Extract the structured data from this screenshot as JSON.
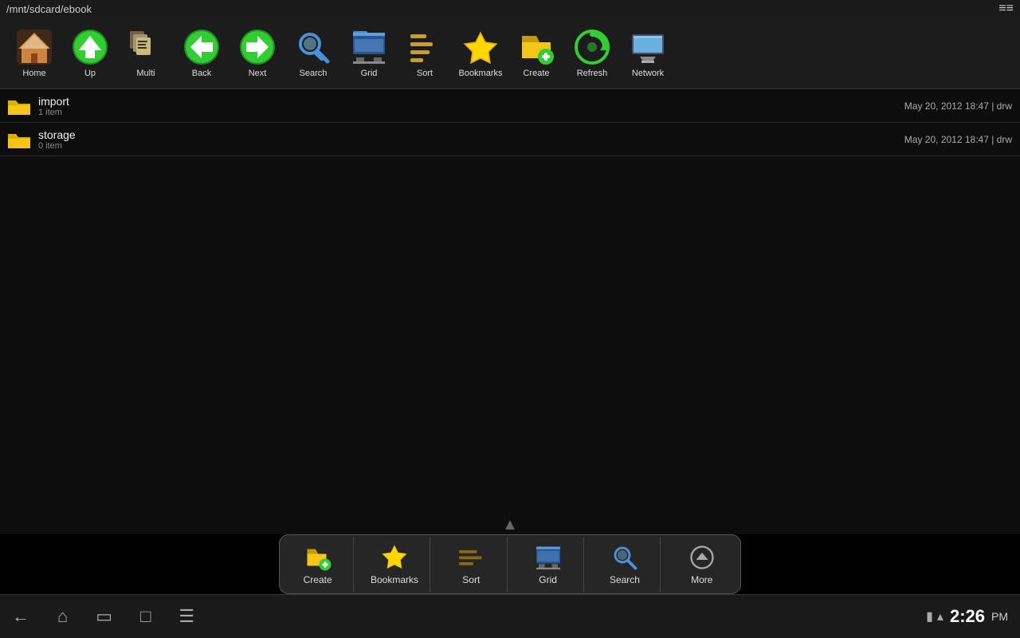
{
  "topbar": {
    "path": "/mnt/sdcard/ebook",
    "menu_icon": "≡"
  },
  "toolbar": {
    "buttons": [
      {
        "id": "home",
        "label": "Home"
      },
      {
        "id": "up",
        "label": "Up"
      },
      {
        "id": "multi",
        "label": "Multi"
      },
      {
        "id": "back",
        "label": "Back"
      },
      {
        "id": "next",
        "label": "Next"
      },
      {
        "id": "search",
        "label": "Search"
      },
      {
        "id": "grid",
        "label": "Grid"
      },
      {
        "id": "sort",
        "label": "Sort"
      },
      {
        "id": "bookmarks",
        "label": "Bookmarks"
      },
      {
        "id": "create",
        "label": "Create"
      },
      {
        "id": "refresh",
        "label": "Refresh"
      },
      {
        "id": "network",
        "label": "Network"
      }
    ]
  },
  "files": [
    {
      "name": "import",
      "sub": "1 item",
      "meta": "May 20, 2012 18:47 | drw"
    },
    {
      "name": "storage",
      "sub": "0 item",
      "meta": "May 20, 2012 18:47 | drw"
    }
  ],
  "dock": {
    "buttons": [
      {
        "id": "create",
        "label": "Create"
      },
      {
        "id": "bookmarks",
        "label": "Bookmarks"
      },
      {
        "id": "sort",
        "label": "Sort"
      },
      {
        "id": "grid",
        "label": "Grid"
      },
      {
        "id": "search",
        "label": "Search"
      },
      {
        "id": "more",
        "label": "More"
      }
    ]
  },
  "systembar": {
    "clock": "2:26",
    "ampm": "PM",
    "nav_buttons": [
      "back",
      "home",
      "recent",
      "screenshot",
      "menu"
    ]
  }
}
